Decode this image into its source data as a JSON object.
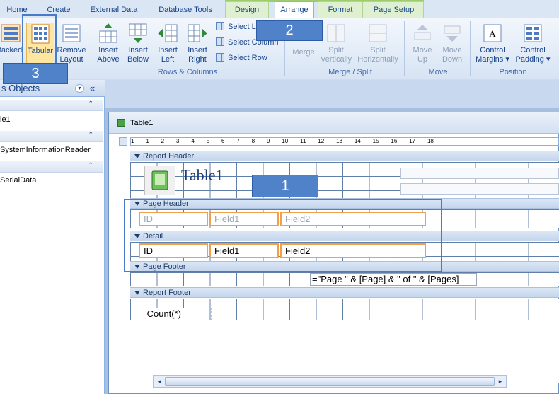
{
  "tabs": [
    {
      "label": "Home"
    },
    {
      "label": "Create"
    },
    {
      "label": "External Data"
    },
    {
      "label": "Database Tools"
    },
    {
      "label": "Design"
    },
    {
      "label": "Arrange"
    },
    {
      "label": "Format"
    },
    {
      "label": "Page Setup"
    }
  ],
  "ribbon": {
    "table": {
      "stacked": "tacked",
      "tabular": "Tabular",
      "remove": "Remove",
      "layout": "Layout"
    },
    "rows_columns": {
      "insert_above_1": "Insert",
      "insert_above_2": "Above",
      "insert_below_1": "Insert",
      "insert_below_2": "Below",
      "insert_left_1": "Insert",
      "insert_left_2": "Left",
      "insert_right_1": "Insert",
      "insert_right_2": "Right",
      "select_layout": "Select La",
      "select_column": "Select Column",
      "select_row": "Select Row",
      "label": "Rows & Columns"
    },
    "merge_split": {
      "merge": "Merge",
      "split_v_1": "Split",
      "split_v_2": "Vertically",
      "split_h_1": "Split",
      "split_h_2": "Horizontally",
      "label": "Merge / Split"
    },
    "move": {
      "up_1": "Move",
      "up_2": "Up",
      "down_1": "Move",
      "down_2": "Down",
      "label": "Move"
    },
    "position": {
      "margins_1": "Control",
      "margins_2": "Margins",
      "padding_1": "Control",
      "padding_2": "Padding",
      "label": "Position"
    }
  },
  "nav": {
    "header": "s Objects",
    "items": [
      "le1",
      "SystemInformationReader",
      "SerialData"
    ]
  },
  "document": {
    "title": "Table1",
    "ruler": "1 · · · 1 · · · 2 · · · 3 · · · 4 · · · 5 · · · 6 · · · 7 · · · 8 · · · 9 · · · 10 · · · 11 · · · 12 · · · 13 · · · 14 · · · 15 · · · 16 · · · 17 · · · 18",
    "sections": {
      "report_header": "Report Header",
      "page_header": "Page Header",
      "detail": "Detail",
      "page_footer": "Page Footer",
      "report_footer": "Report Footer"
    },
    "report_title": "Table1",
    "labels": [
      "ID",
      "Field1",
      "Field2"
    ],
    "fields": [
      "ID",
      "Field1",
      "Field2"
    ],
    "page_expr": "=\"Page \" & [Page] & \" of \" & [Pages]",
    "count_expr": "=Count(*)"
  },
  "callouts": [
    "1",
    "2",
    "3"
  ]
}
